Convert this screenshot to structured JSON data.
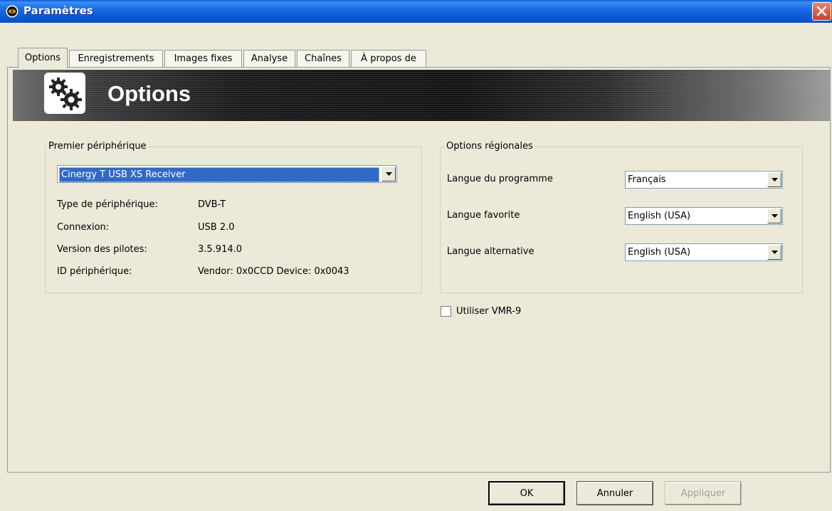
{
  "window": {
    "title": "Paramètres",
    "app_icon": "eye-icon",
    "close_icon": "close-icon",
    "titlebar_color": "#0d5bd7",
    "close_color": "#d54a31"
  },
  "tabs": [
    {
      "label": "Options",
      "active": true
    },
    {
      "label": "Enregistrements",
      "active": false
    },
    {
      "label": "Images fixes",
      "active": false
    },
    {
      "label": "Analyse",
      "active": false
    },
    {
      "label": "Chaînes",
      "active": false
    },
    {
      "label": "À propos de",
      "active": false
    }
  ],
  "banner": {
    "title": "Options",
    "icon": "gears-icon"
  },
  "device_group": {
    "legend": "Premier périphérique",
    "selected_device": "Cinergy T USB XS Receiver",
    "rows": [
      {
        "label": "Type de périphérique:",
        "value": "DVB-T"
      },
      {
        "label": "Connexion:",
        "value": "USB 2.0"
      },
      {
        "label": "Version des pilotes:",
        "value": "3.5.914.0"
      },
      {
        "label": "ID périphérique:",
        "value": "Vendor: 0x0CCD Device: 0x0043"
      }
    ]
  },
  "regional_group": {
    "legend": "Options régionales",
    "rows": [
      {
        "label": "Langue du programme",
        "value": "Français"
      },
      {
        "label": "Langue favorite",
        "value": "English (USA)"
      },
      {
        "label": "Langue alternative",
        "value": "English (USA)"
      }
    ]
  },
  "vmr_checkbox": {
    "label": "Utiliser VMR-9",
    "checked": false
  },
  "buttons": {
    "ok": "OK",
    "cancel": "Annuler",
    "apply": "Appliquer"
  }
}
